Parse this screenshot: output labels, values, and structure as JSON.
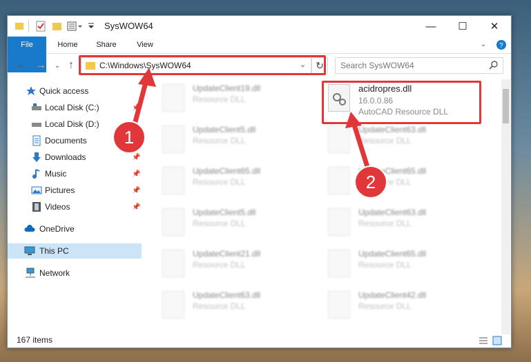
{
  "window": {
    "title": "SysWOW64"
  },
  "ribbon": {
    "tabs": [
      "File",
      "Home",
      "Share",
      "View"
    ]
  },
  "address": {
    "path": "C:\\Windows\\SysWOW64"
  },
  "search": {
    "placeholder": "Search SysWOW64"
  },
  "sidebar": {
    "items": [
      {
        "label": "Quick access"
      },
      {
        "label": "Local Disk (C:)"
      },
      {
        "label": "Local Disk (D:)"
      },
      {
        "label": "Documents"
      },
      {
        "label": "Downloads"
      },
      {
        "label": "Music"
      },
      {
        "label": "Pictures"
      },
      {
        "label": "Videos"
      },
      {
        "label": "OneDrive"
      },
      {
        "label": "This PC"
      },
      {
        "label": "Network"
      }
    ]
  },
  "files": [
    {
      "name": "UpdateClient19.dll",
      "desc": "Resource DLL"
    },
    {
      "name": "acidropres.dll",
      "version": "16.0.0.86",
      "desc": "AutoCAD  Resource DLL"
    },
    {
      "name": "UpdateClient5.dll",
      "desc": "Resource DLL"
    },
    {
      "name": "UpdateClient63.dll",
      "desc": "Resource DLL"
    },
    {
      "name": "UpdateClient65.dll",
      "desc": "Resource DLL"
    },
    {
      "name": "UpdateClient65.dll",
      "desc": "Resource DLL"
    },
    {
      "name": "UpdateClient5.dll",
      "desc": "Resource DLL"
    },
    {
      "name": "UpdateClient63.dll",
      "desc": "Resource DLL"
    },
    {
      "name": "UpdateClient21.dll",
      "desc": "Resource DLL"
    },
    {
      "name": "UpdateClient65.dll",
      "desc": "Resource DLL"
    },
    {
      "name": "UpdateClient63.dll",
      "desc": "Resource DLL"
    },
    {
      "name": "UpdateClient42.dll",
      "desc": "Resource DLL"
    }
  ],
  "status": {
    "count": "167 items"
  },
  "annotations": {
    "badge1": "1",
    "badge2": "2"
  },
  "colors": {
    "accent": "#1979ca",
    "highlight": "#e0383a",
    "selected": "#cce4f7"
  }
}
